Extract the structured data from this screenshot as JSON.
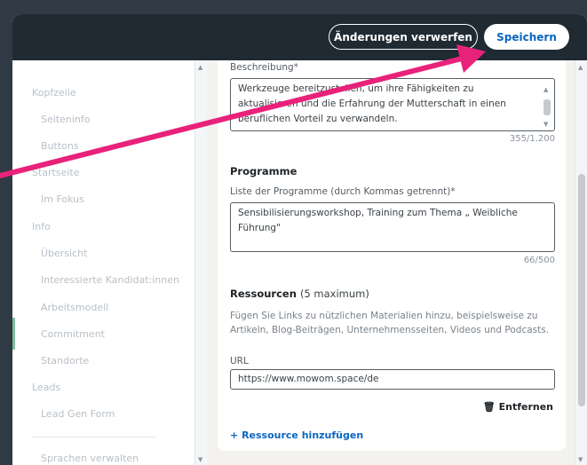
{
  "topbar": {
    "discard_label": "Änderungen verwerfen",
    "save_label": "Speichern"
  },
  "sidebar": {
    "items": [
      {
        "label": "Kopfzeile"
      },
      {
        "label": "Seiteninfo"
      },
      {
        "label": "Buttons"
      },
      {
        "label": "Startseite"
      },
      {
        "label": "Im Fokus"
      },
      {
        "label": "Info"
      },
      {
        "label": "Übersicht"
      },
      {
        "label": "Interessierte Kandidat:innen"
      },
      {
        "label": "Arbeitsmodell"
      },
      {
        "label": "Commitment"
      },
      {
        "label": "Standorte"
      },
      {
        "label": "Leads"
      },
      {
        "label": "Lead Gen Form"
      },
      {
        "label": "Sprachen verwalten"
      }
    ]
  },
  "description": {
    "label": "Beschreibung*",
    "lines": [
      "Werkzeuge bereitzustellen, um ihre Fähigkeiten zu",
      "aktualisieren und die Erfahrung der Mutterschaft in einen",
      "beruflichen Vorteil zu verwandeln."
    ],
    "counter": "355/1.200"
  },
  "programs": {
    "heading": "Programme",
    "label": "Liste der Programme (durch Kommas getrennt)*",
    "value": "Sensibilisierungsworkshop, Training zum Thema „ Weibliche Führung\"",
    "counter": "66/500"
  },
  "resources": {
    "heading": "Ressourcen",
    "heading_note": "(5 maximum)",
    "help": "Fügen Sie Links zu nützlichen Materialien hinzu, beispielsweise zu Artikeln, Blog-Beiträgen, Unternehmensseiten, Videos und Podcasts.",
    "url_label": "URL",
    "url_value": "https://www.mowom.space/de",
    "remove_label": "Entfernen",
    "add_label": "Ressource hinzufügen"
  },
  "colors": {
    "topbar": "#1f2a33",
    "accent": "#0a66c2",
    "annotation_arrow": "#e8227a"
  }
}
